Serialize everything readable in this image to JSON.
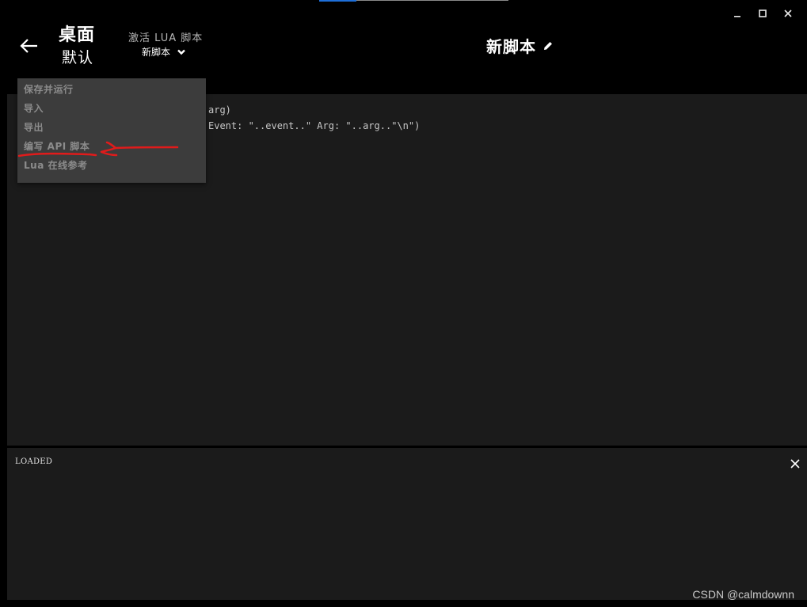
{
  "header": {
    "title": "桌面",
    "profile": "默认",
    "lua_label": "激活 LUA 脚本",
    "selected_script": "新脚本",
    "page_title": "新脚本"
  },
  "menu": {
    "items": [
      {
        "label": "保存并运行"
      },
      {
        "label": "导入"
      },
      {
        "label": "导出"
      },
      {
        "label": "编写 API 脚本"
      },
      {
        "label": "Lua 在线参考"
      }
    ]
  },
  "editor": {
    "lines": [
      "arg)",
      "Event: \"..event..\" Arg: \"..arg..\"\\n\")"
    ]
  },
  "console": {
    "output": "LOADED"
  },
  "icons": {
    "back": "arrow-left-icon",
    "dropdown": "chevron-down-icon",
    "edit": "pencil-icon",
    "close": "close-icon",
    "minimize": "minimize-icon",
    "maximize": "maximize-icon",
    "window_close": "window-close-icon"
  },
  "colors": {
    "background": "#000000",
    "panel": "#1b1b1b",
    "menu_bg": "#3c3c3c",
    "menu_text": "#8c8c8c",
    "annotation": "#e01b1b",
    "accent": "#1e6fd9"
  },
  "watermark": "CSDN @calmdownn"
}
